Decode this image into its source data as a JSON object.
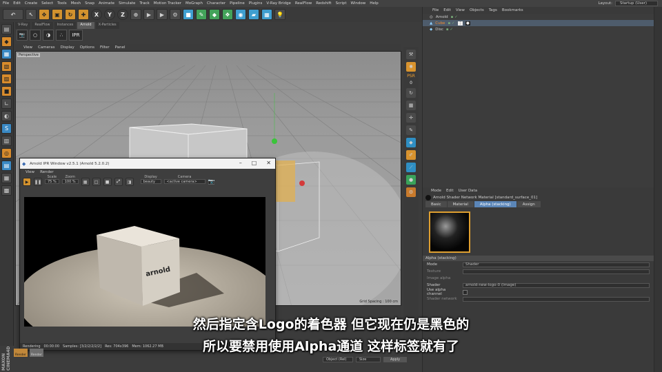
{
  "menubar": {
    "items": [
      "File",
      "Edit",
      "Create",
      "Select",
      "Tools",
      "Mesh",
      "Snap",
      "Animate",
      "Simulate",
      "Track",
      "Motion Tracker",
      "MoGraph",
      "Character",
      "Pipeline",
      "Plugins",
      "V-Ray Bridge",
      "RealFlow",
      "Redshift",
      "Script",
      "Window",
      "Help"
    ],
    "layout_label": "Layout:",
    "layout_value": "Startup (User)"
  },
  "toolbar": {
    "axis_x": "X",
    "axis_y": "Y",
    "axis_z": "Z"
  },
  "viewport": {
    "tabs": [
      "V-Ray",
      "RealFlow",
      "Instances",
      "Arnold",
      "X-Particles"
    ],
    "active_tab": "Arnold",
    "ipr_label": "IPR",
    "menu": [
      "View",
      "Cameras",
      "Display",
      "Options",
      "Filter",
      "Panel"
    ],
    "perspective_label": "Perspective",
    "grid_spacing": "Grid Spacing : 100 cm"
  },
  "right_toolbar": {
    "psr_label": "PSR",
    "psr_value": "0"
  },
  "object_manager": {
    "menu": [
      "File",
      "Edit",
      "View",
      "Objects",
      "Tags",
      "Bookmarks"
    ],
    "objects": [
      {
        "name": "Arnold",
        "color": "#d0d0d0"
      },
      {
        "name": "Cube",
        "color": "#f08a30"
      },
      {
        "name": "Disc",
        "color": "#d0d0d0"
      }
    ]
  },
  "attributes": {
    "menu": [
      "Mode",
      "Edit",
      "User Data"
    ],
    "title": "Arnold Shader Network Material [standard_surface_01]",
    "tabs": [
      "Basic",
      "Material",
      "Alpha (stacking)",
      "Assign"
    ],
    "active_tab": "Alpha (stacking)",
    "section": "Alpha (stacking)",
    "rows": [
      {
        "label": "Mode",
        "value": "Shader"
      },
      {
        "label": "Texture",
        "value": ""
      },
      {
        "label": "Image alpha",
        "value": ""
      },
      {
        "label": "Shader",
        "value": "arnold-new-logo-0 (Image)"
      },
      {
        "label": "Use alpha channel",
        "value": ""
      },
      {
        "label": "Shader network",
        "value": ""
      }
    ]
  },
  "ipr_window": {
    "title": "Arnold IPR Window v2.5.1 (Arnold 5.2.0.2)",
    "menu": [
      "View",
      "Render"
    ],
    "scale_label": "Scale",
    "scale_value": "75 %",
    "zoom_label": "Zoom",
    "zoom_value": "100 %",
    "display_label": "Display",
    "display_value": "beauty",
    "camera_label": "Camera",
    "camera_value": "<active camera>",
    "cube_text": "arnold",
    "status": [
      "Rendering",
      "00:00:00",
      "Samples: [3/2/2/2/2/2]",
      "Res: 704x396",
      "Mem: 1062.27 MB"
    ]
  },
  "bottom": {
    "object_rel": "Object (Rel)",
    "size": "Size",
    "apply": "Apply",
    "thumb1": "Render",
    "thumb2": "Render",
    "maxon": "MAXON CINEMA4D"
  },
  "subtitle": {
    "line1": "然后指定含Logo的着色器 但它现在仍是黑色的",
    "line2": "所以要禁用使用Alpha通道 这样标签就有了"
  }
}
